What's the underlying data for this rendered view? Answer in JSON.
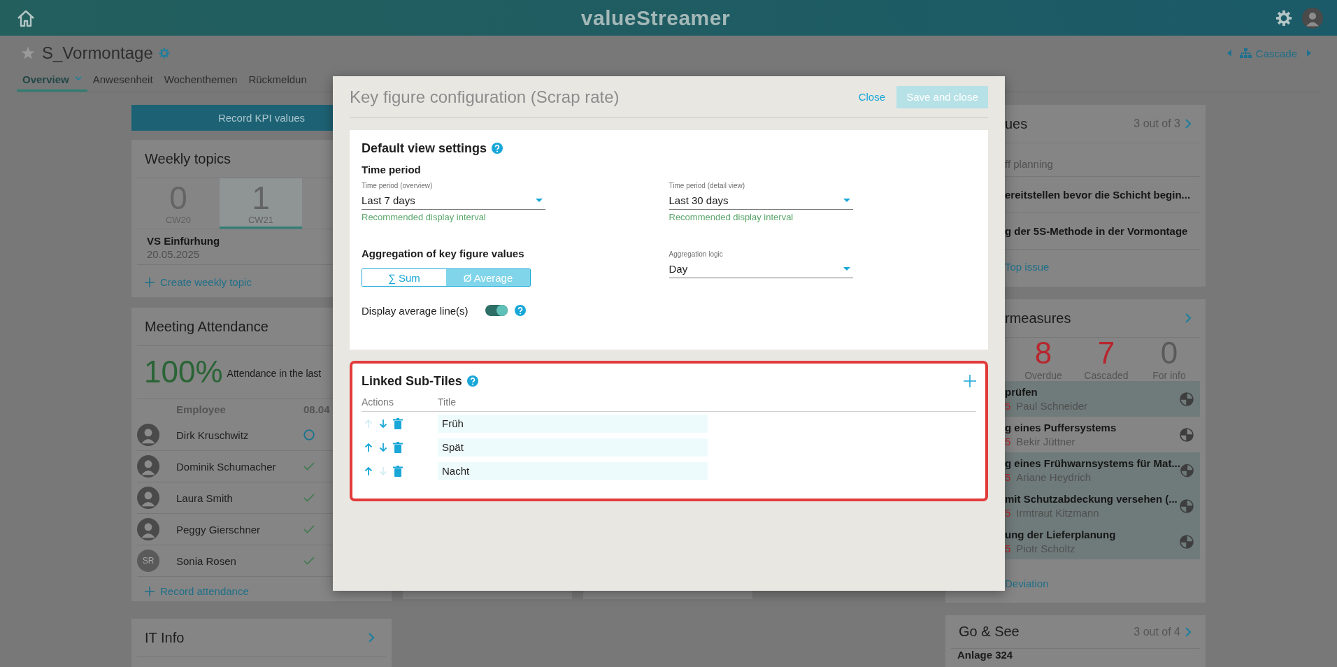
{
  "header": {
    "logo": "valueStreamer"
  },
  "page": {
    "title": "S_Vormontage",
    "favorite": false,
    "cascade": "Cascade",
    "tabs": [
      {
        "label": "Overview",
        "selected": true
      },
      {
        "label": "Anwesenheit",
        "selected": false
      },
      {
        "label": "Wochenthemen",
        "selected": false
      },
      {
        "label": "Rückmeldun",
        "selected": false
      }
    ]
  },
  "left": {
    "record_button": "Record KPI values",
    "weekly_topics": {
      "title": "Weekly topics",
      "weeks": [
        {
          "count": "0",
          "label": "CW20",
          "selected": false
        },
        {
          "count": "1",
          "label": "CW21",
          "selected": true
        }
      ],
      "topics": [
        {
          "title": "VS Einfürhung",
          "date": "20.05.2025"
        }
      ],
      "action": "Create weekly topic"
    },
    "attendance": {
      "title": "Meeting Attendance",
      "rate": "100%",
      "caption": "Attendance in the last",
      "columns": [
        "Employee",
        "08.04"
      ],
      "rows": [
        {
          "name": "Dirk Kruschwitz",
          "attended": false
        },
        {
          "name": "Dominik Schumacher",
          "attended": true
        },
        {
          "name": "Laura Smith",
          "attended": true
        },
        {
          "name": "Peggy Gierschner",
          "attended": true
        },
        {
          "name": "Sonia Rosen",
          "initials": "SR",
          "attended": true
        }
      ],
      "action": "Record attendance"
    },
    "it_info": {
      "title": "IT Info"
    }
  },
  "right": {
    "issues": {
      "title": "ues",
      "count": "3 out of 3",
      "items": [
        {
          "kind": "label",
          "text": "ff planning"
        },
        {
          "kind": "issue",
          "text": "ereitstellen bevor die Schicht begin..."
        },
        {
          "kind": "issue",
          "text": "g der 5S-Methode in der Vormontage"
        }
      ],
      "action": "Top issue"
    },
    "measures": {
      "title": "rmeasures",
      "counts": [
        {
          "value": "8",
          "label": "Overdue",
          "color": "#b8262e"
        },
        {
          "value": "7",
          "label": "Cascaded",
          "color": "#b8262e"
        },
        {
          "value": "0",
          "label": "For info",
          "color": "#5a5a5a"
        }
      ],
      "items": [
        {
          "title": "prüfen",
          "date": "5",
          "person": "Paul Schneider",
          "highlighted": true
        },
        {
          "title": "g eines Puffersystems",
          "date": "5",
          "person": "Bekir Jüttner",
          "highlighted": false
        },
        {
          "title": "g eines Frühwarnsystems für Mat...",
          "date": "5",
          "person": "Ariane Heydrich",
          "highlighted": true
        },
        {
          "title": "mit Schutzabdeckung versehen (...",
          "date": "5",
          "person": "Irmtraut Kitzmann",
          "highlighted": true
        },
        {
          "title": "ung der Lieferplanung",
          "date": "5",
          "person": "Piotr Scholtz",
          "highlighted": true
        }
      ],
      "action": "Deviation"
    },
    "go_see": {
      "title": "Go & See",
      "count": "3 out of 4",
      "items": [
        {
          "title": "Anlage 324"
        }
      ]
    }
  },
  "modal": {
    "title": "Key figure configuration (Scrap rate)",
    "close": "Close",
    "save": {
      "label": "Save and close",
      "disabled": true
    },
    "default_view": {
      "title": "Default view settings",
      "time_heading": "Time period",
      "fields": [
        {
          "label": "Time period (overview)",
          "value": "Last 7 days",
          "hint": "Recommended display interval"
        },
        {
          "label": "Time period (detail view)",
          "value": "Last 30 days",
          "hint": "Recommended display interval"
        }
      ],
      "aggregation_heading": "Aggregation of key figure values",
      "aggregation": [
        {
          "label": "∑ Sum",
          "selected": false
        },
        {
          "label": "Ø Average",
          "selected": true
        }
      ],
      "logic": {
        "label": "Aggregation logic",
        "value": "Day"
      },
      "average_line": {
        "label": "Display average line(s)",
        "on": true
      }
    },
    "sub_tiles": {
      "title": "Linked Sub-Tiles",
      "highlighted": true,
      "columns": [
        "Actions",
        "Title"
      ],
      "rows": [
        {
          "title": "Früh",
          "can_move_up": false,
          "can_move_down": true
        },
        {
          "title": "Spät",
          "can_move_up": true,
          "can_move_down": true
        },
        {
          "title": "Nacht",
          "can_move_up": true,
          "can_move_down": false
        }
      ]
    }
  }
}
